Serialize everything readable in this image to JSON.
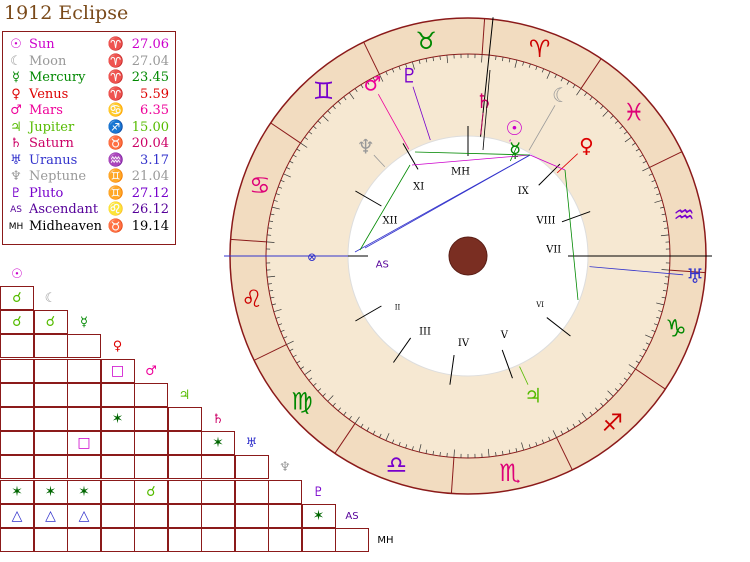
{
  "title": "1912 Eclipse",
  "legend": [
    {
      "glyph": "☉",
      "name": "Sun",
      "sign": "♈",
      "value": "27.06",
      "color": "#cc00cc"
    },
    {
      "glyph": "☾",
      "name": "Moon",
      "sign": "♈",
      "value": "27.04",
      "color": "#999999"
    },
    {
      "glyph": "☿",
      "name": "Mercury",
      "sign": "♈",
      "value": "23.45",
      "color": "#008800"
    },
    {
      "glyph": "♀",
      "name": "Venus",
      "sign": "♈",
      "value": "5.59",
      "color": "#dd0000"
    },
    {
      "glyph": "♂",
      "name": "Mars",
      "sign": "♋",
      "value": "6.35",
      "color": "#ee0099"
    },
    {
      "glyph": "♃",
      "name": "Jupiter",
      "sign": "♐",
      "value": "15.00",
      "color": "#55bb00"
    },
    {
      "glyph": "♄",
      "name": "Saturn",
      "sign": "♉",
      "value": "20.04",
      "color": "#cc0066"
    },
    {
      "glyph": "♅",
      "name": "Uranus",
      "sign": "♒",
      "value": "3.17",
      "color": "#3333cc"
    },
    {
      "glyph": "♆",
      "name": "Neptune",
      "sign": "♊",
      "value": "21.04",
      "color": "#999999"
    },
    {
      "glyph": "♇",
      "name": "Pluto",
      "sign": "♊",
      "value": "27.12",
      "color": "#7700cc"
    },
    {
      "glyph": "AS",
      "name": "Ascendant",
      "sign": "♌",
      "value": "26.12",
      "color": "#550099"
    },
    {
      "glyph": "MH",
      "name": "Midheaven",
      "sign": "♉",
      "value": "19.14",
      "color": "#000000"
    }
  ],
  "aspect_grid": {
    "diagonal": [
      {
        "glyph": "☉",
        "color": "#cc00cc"
      },
      {
        "glyph": "☾",
        "color": "#999999"
      },
      {
        "glyph": "☿",
        "color": "#008800"
      },
      {
        "glyph": "♀",
        "color": "#dd0000"
      },
      {
        "glyph": "♂",
        "color": "#ee0099"
      },
      {
        "glyph": "♃",
        "color": "#55bb00"
      },
      {
        "glyph": "♄",
        "color": "#cc0066"
      },
      {
        "glyph": "♅",
        "color": "#3333cc"
      },
      {
        "glyph": "♆",
        "color": "#999999"
      },
      {
        "glyph": "♇",
        "color": "#7700cc"
      },
      {
        "glyph": "AS",
        "color": "#550099"
      },
      {
        "glyph": "MH",
        "color": "#000000"
      }
    ],
    "aspects": [
      {
        "row": 1,
        "col": 0,
        "glyph": "☌",
        "color": "#55bb00"
      },
      {
        "row": 2,
        "col": 0,
        "glyph": "☌",
        "color": "#55bb00"
      },
      {
        "row": 2,
        "col": 1,
        "glyph": "☌",
        "color": "#55bb00"
      },
      {
        "row": 4,
        "col": 3,
        "glyph": "□",
        "color": "#cc00cc"
      },
      {
        "row": 6,
        "col": 3,
        "glyph": "✶",
        "color": "#006600"
      },
      {
        "row": 7,
        "col": 2,
        "glyph": "□",
        "color": "#cc00cc"
      },
      {
        "row": 7,
        "col": 6,
        "glyph": "✶",
        "color": "#006600"
      },
      {
        "row": 9,
        "col": 0,
        "glyph": "✶",
        "color": "#006600"
      },
      {
        "row": 9,
        "col": 1,
        "glyph": "✶",
        "color": "#006600"
      },
      {
        "row": 9,
        "col": 2,
        "glyph": "✶",
        "color": "#006600"
      },
      {
        "row": 9,
        "col": 4,
        "glyph": "☌",
        "color": "#55bb00"
      },
      {
        "row": 10,
        "col": 0,
        "glyph": "△",
        "color": "#3333cc"
      },
      {
        "row": 10,
        "col": 1,
        "glyph": "△",
        "color": "#3333cc"
      },
      {
        "row": 10,
        "col": 2,
        "glyph": "△",
        "color": "#3333cc"
      },
      {
        "row": 10,
        "col": 9,
        "glyph": "✶",
        "color": "#006600"
      }
    ]
  },
  "wheel": {
    "signs": [
      {
        "glyph": "♈",
        "color": "#cc0000"
      },
      {
        "glyph": "♉",
        "color": "#008800"
      },
      {
        "glyph": "♊",
        "color": "#7700cc"
      },
      {
        "glyph": "♋",
        "color": "#dd0077"
      },
      {
        "glyph": "♌",
        "color": "#cc0000"
      },
      {
        "glyph": "♍",
        "color": "#008800"
      },
      {
        "glyph": "♎",
        "color": "#7700cc"
      },
      {
        "glyph": "♏",
        "color": "#dd0077"
      },
      {
        "glyph": "♐",
        "color": "#cc0000"
      },
      {
        "glyph": "♑",
        "color": "#008800"
      },
      {
        "glyph": "♒",
        "color": "#7700cc"
      },
      {
        "glyph": "♓",
        "color": "#dd0077"
      }
    ],
    "houses": [
      "II",
      "III",
      "IV",
      "V",
      "VI",
      "VII",
      "VIII",
      "IX",
      "MH",
      "XI",
      "XII",
      "AS"
    ],
    "planets": [
      {
        "glyph": "☉",
        "color": "#cc00cc"
      },
      {
        "glyph": "☾",
        "color": "#999999"
      },
      {
        "glyph": "☿",
        "color": "#008800"
      },
      {
        "glyph": "♀",
        "color": "#dd0000"
      },
      {
        "glyph": "♂",
        "color": "#ee0099"
      },
      {
        "glyph": "♃",
        "color": "#55bb00"
      },
      {
        "glyph": "♄",
        "color": "#cc0066"
      },
      {
        "glyph": "♅",
        "color": "#3333cc"
      },
      {
        "glyph": "♆",
        "color": "#999999"
      },
      {
        "glyph": "♇",
        "color": "#7700cc"
      }
    ],
    "ascendant_marker": "⊗"
  }
}
